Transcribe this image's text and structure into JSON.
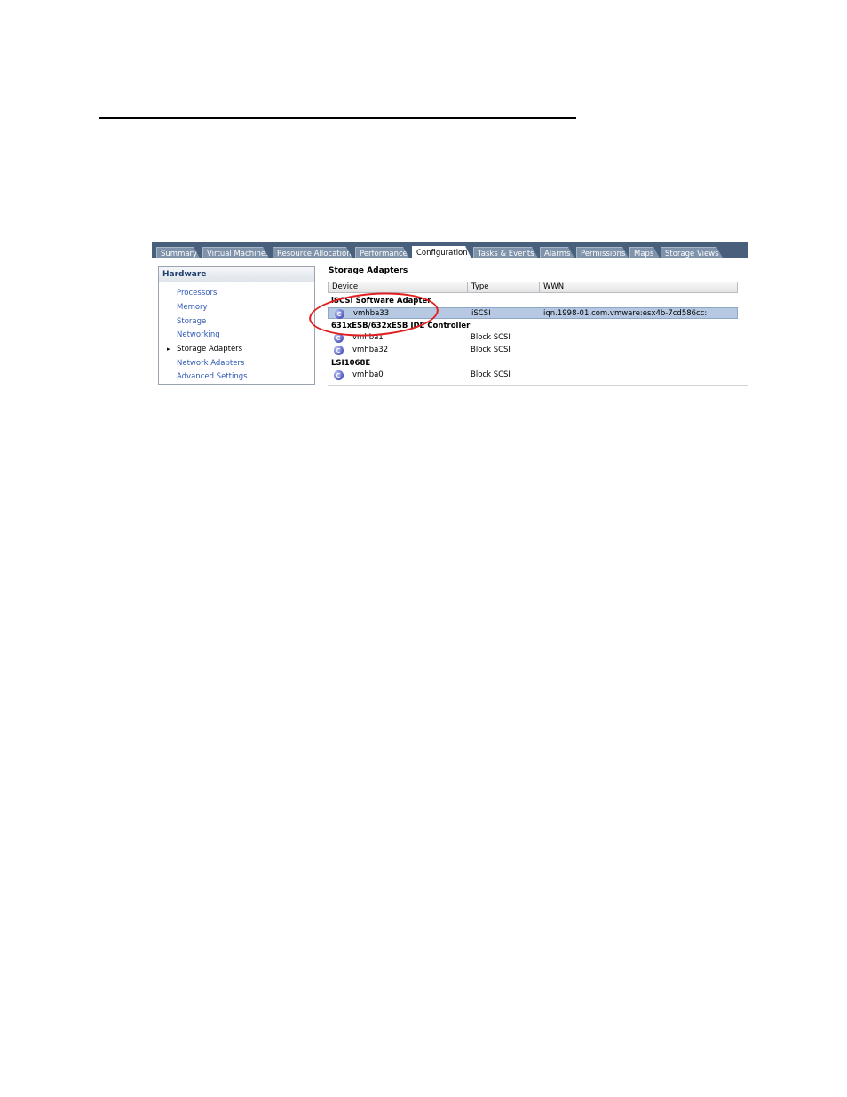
{
  "tabs": [
    {
      "label": "Summary",
      "active": false
    },
    {
      "label": "Virtual Machines",
      "active": false
    },
    {
      "label": "Resource Allocation",
      "active": false
    },
    {
      "label": "Performance",
      "active": false
    },
    {
      "label": "Configuration",
      "active": true
    },
    {
      "label": "Tasks & Events",
      "active": false
    },
    {
      "label": "Alarms",
      "active": false
    },
    {
      "label": "Permissions",
      "active": false
    },
    {
      "label": "Maps",
      "active": false
    },
    {
      "label": "Storage Views",
      "active": false
    }
  ],
  "hardware": {
    "title": "Hardware",
    "items": [
      "Processors",
      "Memory",
      "Storage",
      "Networking",
      "Storage Adapters",
      "Network Adapters",
      "Advanced Settings"
    ],
    "selected": "Storage Adapters"
  },
  "storage_adapters": {
    "title": "Storage Adapters",
    "columns": [
      "Device",
      "Type",
      "WWN"
    ],
    "groups": [
      {
        "name": "iSCSI Software Adapter",
        "rows": [
          {
            "device": "vmhba33",
            "type": "iSCSI",
            "wwn": "iqn.1998-01.com.vmware:esx4b-7cd586cc:",
            "selected": true
          }
        ]
      },
      {
        "name": "631xESB/632xESB IDE Controller",
        "rows": [
          {
            "device": "vmhba1",
            "type": "Block SCSI",
            "wwn": ""
          },
          {
            "device": "vmhba32",
            "type": "Block SCSI",
            "wwn": ""
          }
        ]
      },
      {
        "name": "LSI1068E",
        "rows": [
          {
            "device": "vmhba0",
            "type": "Block SCSI",
            "wwn": ""
          }
        ]
      }
    ]
  },
  "colors": {
    "tabbar": "#48607c",
    "tab": "#7f93ab",
    "link": "#2f58b5",
    "selection": "#b7c9e2",
    "callout": "#e02020"
  }
}
